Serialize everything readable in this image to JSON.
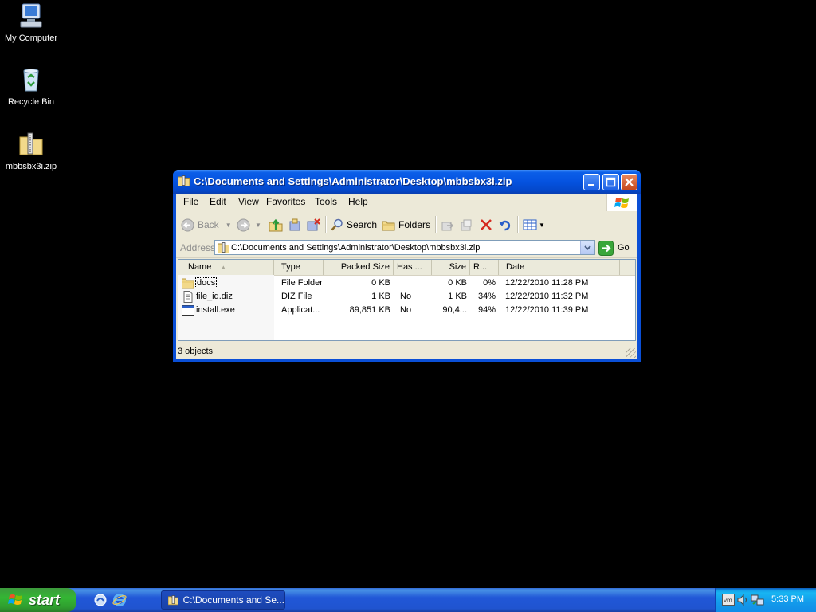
{
  "desktop": {
    "icons": [
      {
        "label": "My Computer"
      },
      {
        "label": "Recycle Bin"
      },
      {
        "label": "mbbsbx3i.zip"
      }
    ]
  },
  "window": {
    "title": "C:\\Documents and Settings\\Administrator\\Desktop\\mbbsbx3i.zip",
    "menu": [
      "File",
      "Edit",
      "View",
      "Favorites",
      "Tools",
      "Help"
    ],
    "toolbar": {
      "back": "Back",
      "search": "Search",
      "folders": "Folders"
    },
    "address": {
      "label": "Address",
      "value": "C:\\Documents and Settings\\Administrator\\Desktop\\mbbsbx3i.zip",
      "go": "Go"
    },
    "columns": [
      "Name",
      "Type",
      "Packed Size",
      "Has ...",
      "Size",
      "R...",
      "Date"
    ],
    "rows": [
      {
        "name": "docs",
        "type": "File Folder",
        "packed": "0 KB",
        "has": "",
        "size": "0 KB",
        "ratio": "0%",
        "date": "12/22/2010 11:28 PM"
      },
      {
        "name": "file_id.diz",
        "type": "DIZ File",
        "packed": "1 KB",
        "has": "No",
        "size": "1 KB",
        "ratio": "34%",
        "date": "12/22/2010 11:32 PM"
      },
      {
        "name": "install.exe",
        "type": "Applicat...",
        "packed": "89,851 KB",
        "has": "No",
        "size": "90,4...",
        "ratio": "94%",
        "date": "12/22/2010 11:39 PM"
      }
    ],
    "status": "3 objects"
  },
  "taskbar": {
    "start": "start",
    "task": "C:\\Documents and Se...",
    "clock": "5:33 PM"
  }
}
